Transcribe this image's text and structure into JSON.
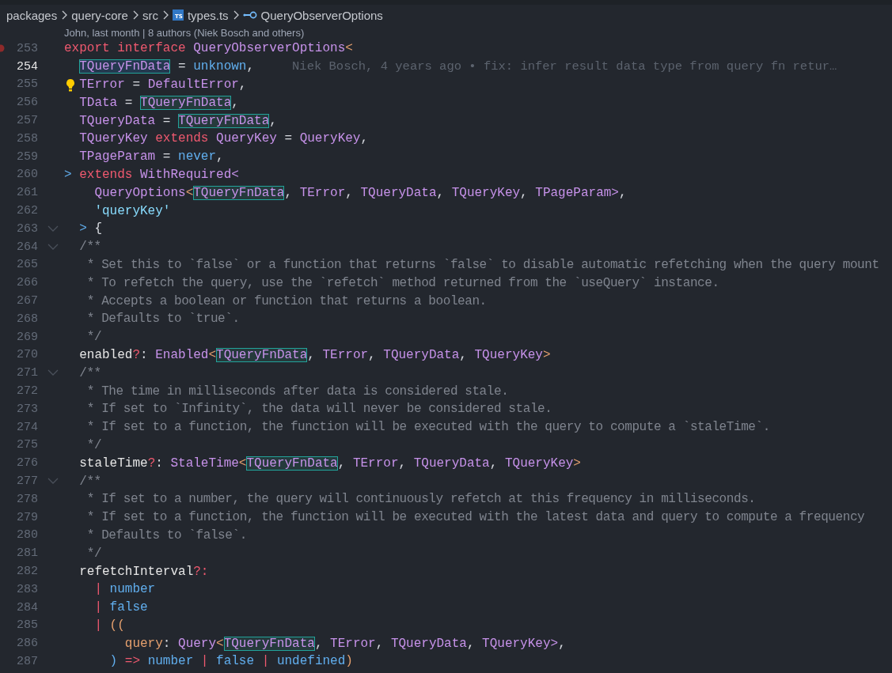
{
  "breadcrumbs": [
    {
      "kind": "folder",
      "label": "packages"
    },
    {
      "kind": "folder",
      "label": "query-core"
    },
    {
      "kind": "folder",
      "label": "src"
    },
    {
      "kind": "file",
      "label": "types.ts",
      "icon_label": "TS"
    },
    {
      "kind": "symbol",
      "label": "QueryObserverOptions"
    }
  ],
  "code_lens": "John, last month | 8 authors (Niek Bosch and others)",
  "lines": [
    {
      "number": "253",
      "active": false,
      "breakpoint": true,
      "lightbulb": false,
      "foldable": false,
      "tokens": [
        {
          "kind": "keyword",
          "text": "export "
        },
        {
          "kind": "keyword",
          "text": "interface "
        },
        {
          "kind": "type",
          "text": "QueryObserverOptions"
        },
        {
          "kind": "bracket",
          "text": "<"
        }
      ]
    },
    {
      "number": "254",
      "active": true,
      "breakpoint": false,
      "lightbulb": false,
      "foldable": false,
      "blame": "Niek Bosch, 4 years ago • fix: infer result data type from query fn retur…",
      "tokens": [
        {
          "kind": "match-current",
          "text": "  TQueryFnData"
        },
        {
          "kind": "punct",
          "text": " = "
        },
        {
          "kind": "primitive",
          "text": "unknown"
        },
        {
          "kind": "punct",
          "text": ","
        }
      ]
    },
    {
      "number": "255",
      "active": false,
      "breakpoint": false,
      "lightbulb": true,
      "foldable": false,
      "tokens": [
        {
          "kind": "type",
          "text": "  TError"
        },
        {
          "kind": "punct",
          "text": " = "
        },
        {
          "kind": "type",
          "text": "DefaultError"
        },
        {
          "kind": "punct",
          "text": ","
        }
      ]
    },
    {
      "number": "256",
      "active": false,
      "breakpoint": false,
      "lightbulb": false,
      "foldable": false,
      "tokens": [
        {
          "kind": "type",
          "text": "  TData"
        },
        {
          "kind": "punct",
          "text": " = "
        },
        {
          "kind": "match",
          "text": "TQueryFnData"
        },
        {
          "kind": "punct",
          "text": ","
        }
      ]
    },
    {
      "number": "257",
      "active": false,
      "breakpoint": false,
      "lightbulb": false,
      "foldable": false,
      "tokens": [
        {
          "kind": "type",
          "text": "  TQueryData"
        },
        {
          "kind": "punct",
          "text": " = "
        },
        {
          "kind": "match",
          "text": "TQueryFnData"
        },
        {
          "kind": "punct",
          "text": ","
        }
      ]
    },
    {
      "number": "258",
      "active": false,
      "breakpoint": false,
      "lightbulb": false,
      "foldable": false,
      "tokens": [
        {
          "kind": "type",
          "text": "  TQueryKey "
        },
        {
          "kind": "keyword",
          "text": "extends "
        },
        {
          "kind": "type",
          "text": "QueryKey"
        },
        {
          "kind": "punct",
          "text": " = "
        },
        {
          "kind": "type",
          "text": "QueryKey"
        },
        {
          "kind": "punct",
          "text": ","
        }
      ]
    },
    {
      "number": "259",
      "active": false,
      "breakpoint": false,
      "lightbulb": false,
      "foldable": false,
      "tokens": [
        {
          "kind": "type",
          "text": "  TPageParam"
        },
        {
          "kind": "punct",
          "text": " = "
        },
        {
          "kind": "primitive",
          "text": "never"
        },
        {
          "kind": "punct",
          "text": ","
        }
      ]
    },
    {
      "number": "260",
      "active": false,
      "breakpoint": false,
      "lightbulb": false,
      "foldable": false,
      "tokens": [
        {
          "kind": "primitive",
          "text": "> "
        },
        {
          "kind": "keyword",
          "text": "extends "
        },
        {
          "kind": "type",
          "text": "WithRequired<"
        }
      ]
    },
    {
      "number": "261",
      "active": false,
      "breakpoint": false,
      "lightbulb": false,
      "foldable": false,
      "tokens": [
        {
          "kind": "type",
          "text": "    QueryOptions"
        },
        {
          "kind": "bracket",
          "text": "<"
        },
        {
          "kind": "match",
          "text": "TQueryFnData"
        },
        {
          "kind": "punct",
          "text": ", "
        },
        {
          "kind": "type",
          "text": "TError"
        },
        {
          "kind": "punct",
          "text": ", "
        },
        {
          "kind": "type",
          "text": "TQueryData"
        },
        {
          "kind": "punct",
          "text": ", "
        },
        {
          "kind": "type",
          "text": "TQueryKey"
        },
        {
          "kind": "punct",
          "text": ", "
        },
        {
          "kind": "type",
          "text": "TPageParam>"
        },
        {
          "kind": "punct",
          "text": ","
        }
      ]
    },
    {
      "number": "262",
      "active": false,
      "breakpoint": false,
      "lightbulb": false,
      "foldable": false,
      "tokens": [
        {
          "kind": "string",
          "text": "    'queryKey'"
        }
      ]
    },
    {
      "number": "263",
      "active": false,
      "breakpoint": false,
      "lightbulb": false,
      "foldable": true,
      "tokens": [
        {
          "kind": "primitive",
          "text": "  > "
        },
        {
          "kind": "punct",
          "text": "{"
        }
      ]
    },
    {
      "number": "264",
      "active": false,
      "breakpoint": false,
      "lightbulb": false,
      "foldable": true,
      "tokens": [
        {
          "kind": "comment",
          "text": "  /**"
        }
      ]
    },
    {
      "number": "265",
      "active": false,
      "breakpoint": false,
      "lightbulb": false,
      "foldable": false,
      "tokens": [
        {
          "kind": "comment",
          "text": "   * Set this to `false` or a function that returns `false` to disable automatic refetching when the query mount"
        }
      ]
    },
    {
      "number": "266",
      "active": false,
      "breakpoint": false,
      "lightbulb": false,
      "foldable": false,
      "tokens": [
        {
          "kind": "comment",
          "text": "   * To refetch the query, use the `refetch` method returned from the `useQuery` instance."
        }
      ]
    },
    {
      "number": "267",
      "active": false,
      "breakpoint": false,
      "lightbulb": false,
      "foldable": false,
      "tokens": [
        {
          "kind": "comment",
          "text": "   * Accepts a boolean or function that returns a boolean."
        }
      ]
    },
    {
      "number": "268",
      "active": false,
      "breakpoint": false,
      "lightbulb": false,
      "foldable": false,
      "tokens": [
        {
          "kind": "comment",
          "text": "   * Defaults to `true`."
        }
      ]
    },
    {
      "number": "269",
      "active": false,
      "breakpoint": false,
      "lightbulb": false,
      "foldable": false,
      "tokens": [
        {
          "kind": "comment",
          "text": "   */"
        }
      ]
    },
    {
      "number": "270",
      "active": false,
      "breakpoint": false,
      "lightbulb": false,
      "foldable": false,
      "tokens": [
        {
          "kind": "property",
          "text": "  enabled"
        },
        {
          "kind": "operator",
          "text": "?"
        },
        {
          "kind": "punct",
          "text": ": "
        },
        {
          "kind": "type",
          "text": "Enabled"
        },
        {
          "kind": "bracket",
          "text": "<"
        },
        {
          "kind": "match",
          "text": "TQueryFnData"
        },
        {
          "kind": "punct",
          "text": ", "
        },
        {
          "kind": "type",
          "text": "TError"
        },
        {
          "kind": "punct",
          "text": ", "
        },
        {
          "kind": "type",
          "text": "TQueryData"
        },
        {
          "kind": "punct",
          "text": ", "
        },
        {
          "kind": "type",
          "text": "TQueryKey"
        },
        {
          "kind": "bracket",
          "text": ">"
        }
      ]
    },
    {
      "number": "271",
      "active": false,
      "breakpoint": false,
      "lightbulb": false,
      "foldable": true,
      "tokens": [
        {
          "kind": "comment",
          "text": "  /**"
        }
      ]
    },
    {
      "number": "272",
      "active": false,
      "breakpoint": false,
      "lightbulb": false,
      "foldable": false,
      "tokens": [
        {
          "kind": "comment",
          "text": "   * The time in milliseconds after data is considered stale."
        }
      ]
    },
    {
      "number": "273",
      "active": false,
      "breakpoint": false,
      "lightbulb": false,
      "foldable": false,
      "tokens": [
        {
          "kind": "comment",
          "text": "   * If set to `Infinity`, the data will never be considered stale."
        }
      ]
    },
    {
      "number": "274",
      "active": false,
      "breakpoint": false,
      "lightbulb": false,
      "foldable": false,
      "tokens": [
        {
          "kind": "comment",
          "text": "   * If set to a function, the function will be executed with the query to compute a `staleTime`."
        }
      ]
    },
    {
      "number": "275",
      "active": false,
      "breakpoint": false,
      "lightbulb": false,
      "foldable": false,
      "tokens": [
        {
          "kind": "comment",
          "text": "   */"
        }
      ]
    },
    {
      "number": "276",
      "active": false,
      "breakpoint": false,
      "lightbulb": false,
      "foldable": false,
      "tokens": [
        {
          "kind": "property",
          "text": "  staleTime"
        },
        {
          "kind": "operator",
          "text": "?"
        },
        {
          "kind": "punct",
          "text": ": "
        },
        {
          "kind": "type",
          "text": "StaleTime"
        },
        {
          "kind": "bracket",
          "text": "<"
        },
        {
          "kind": "match",
          "text": "TQueryFnData"
        },
        {
          "kind": "punct",
          "text": ", "
        },
        {
          "kind": "type",
          "text": "TError"
        },
        {
          "kind": "punct",
          "text": ", "
        },
        {
          "kind": "type",
          "text": "TQueryData"
        },
        {
          "kind": "punct",
          "text": ", "
        },
        {
          "kind": "type",
          "text": "TQueryKey"
        },
        {
          "kind": "bracket",
          "text": ">"
        }
      ]
    },
    {
      "number": "277",
      "active": false,
      "breakpoint": false,
      "lightbulb": false,
      "foldable": true,
      "tokens": [
        {
          "kind": "comment",
          "text": "  /**"
        }
      ]
    },
    {
      "number": "278",
      "active": false,
      "breakpoint": false,
      "lightbulb": false,
      "foldable": false,
      "tokens": [
        {
          "kind": "comment",
          "text": "   * If set to a number, the query will continuously refetch at this frequency in milliseconds."
        }
      ]
    },
    {
      "number": "279",
      "active": false,
      "breakpoint": false,
      "lightbulb": false,
      "foldable": false,
      "tokens": [
        {
          "kind": "comment",
          "text": "   * If set to a function, the function will be executed with the latest data and query to compute a frequency"
        }
      ]
    },
    {
      "number": "280",
      "active": false,
      "breakpoint": false,
      "lightbulb": false,
      "foldable": false,
      "tokens": [
        {
          "kind": "comment",
          "text": "   * Defaults to `false`."
        }
      ]
    },
    {
      "number": "281",
      "active": false,
      "breakpoint": false,
      "lightbulb": false,
      "foldable": false,
      "tokens": [
        {
          "kind": "comment",
          "text": "   */"
        }
      ]
    },
    {
      "number": "282",
      "active": false,
      "breakpoint": false,
      "lightbulb": false,
      "foldable": false,
      "tokens": [
        {
          "kind": "property",
          "text": "  refetchInterval"
        },
        {
          "kind": "operator",
          "text": "?:"
        }
      ]
    },
    {
      "number": "283",
      "active": false,
      "breakpoint": false,
      "lightbulb": false,
      "foldable": false,
      "tokens": [
        {
          "kind": "operator",
          "text": "    | "
        },
        {
          "kind": "primitive",
          "text": "number"
        }
      ]
    },
    {
      "number": "284",
      "active": false,
      "breakpoint": false,
      "lightbulb": false,
      "foldable": false,
      "tokens": [
        {
          "kind": "operator",
          "text": "    | "
        },
        {
          "kind": "primitive",
          "text": "false"
        }
      ]
    },
    {
      "number": "285",
      "active": false,
      "breakpoint": false,
      "lightbulb": false,
      "foldable": false,
      "tokens": [
        {
          "kind": "operator",
          "text": "    | "
        },
        {
          "kind": "bracket",
          "text": "(("
        }
      ]
    },
    {
      "number": "286",
      "active": false,
      "breakpoint": false,
      "lightbulb": false,
      "foldable": false,
      "tokens": [
        {
          "kind": "parameter",
          "text": "        query"
        },
        {
          "kind": "punct",
          "text": ": "
        },
        {
          "kind": "type",
          "text": "Query"
        },
        {
          "kind": "bracket",
          "text": "<"
        },
        {
          "kind": "match",
          "text": "TQueryFnData"
        },
        {
          "kind": "punct",
          "text": ", "
        },
        {
          "kind": "type",
          "text": "TError"
        },
        {
          "kind": "punct",
          "text": ", "
        },
        {
          "kind": "type",
          "text": "TQueryData"
        },
        {
          "kind": "punct",
          "text": ", "
        },
        {
          "kind": "type",
          "text": "TQueryKey>"
        },
        {
          "kind": "punct",
          "text": ","
        }
      ]
    },
    {
      "number": "287",
      "active": false,
      "breakpoint": false,
      "lightbulb": false,
      "foldable": false,
      "tokens": [
        {
          "kind": "primitive",
          "text": "      )"
        },
        {
          "kind": "operator",
          "text": " => "
        },
        {
          "kind": "primitive",
          "text": "number"
        },
        {
          "kind": "operator",
          "text": " | "
        },
        {
          "kind": "primitive",
          "text": "false"
        },
        {
          "kind": "operator",
          "text": " | "
        },
        {
          "kind": "primitive",
          "text": "undefined"
        },
        {
          "kind": "bracket",
          "text": ")"
        }
      ]
    }
  ]
}
